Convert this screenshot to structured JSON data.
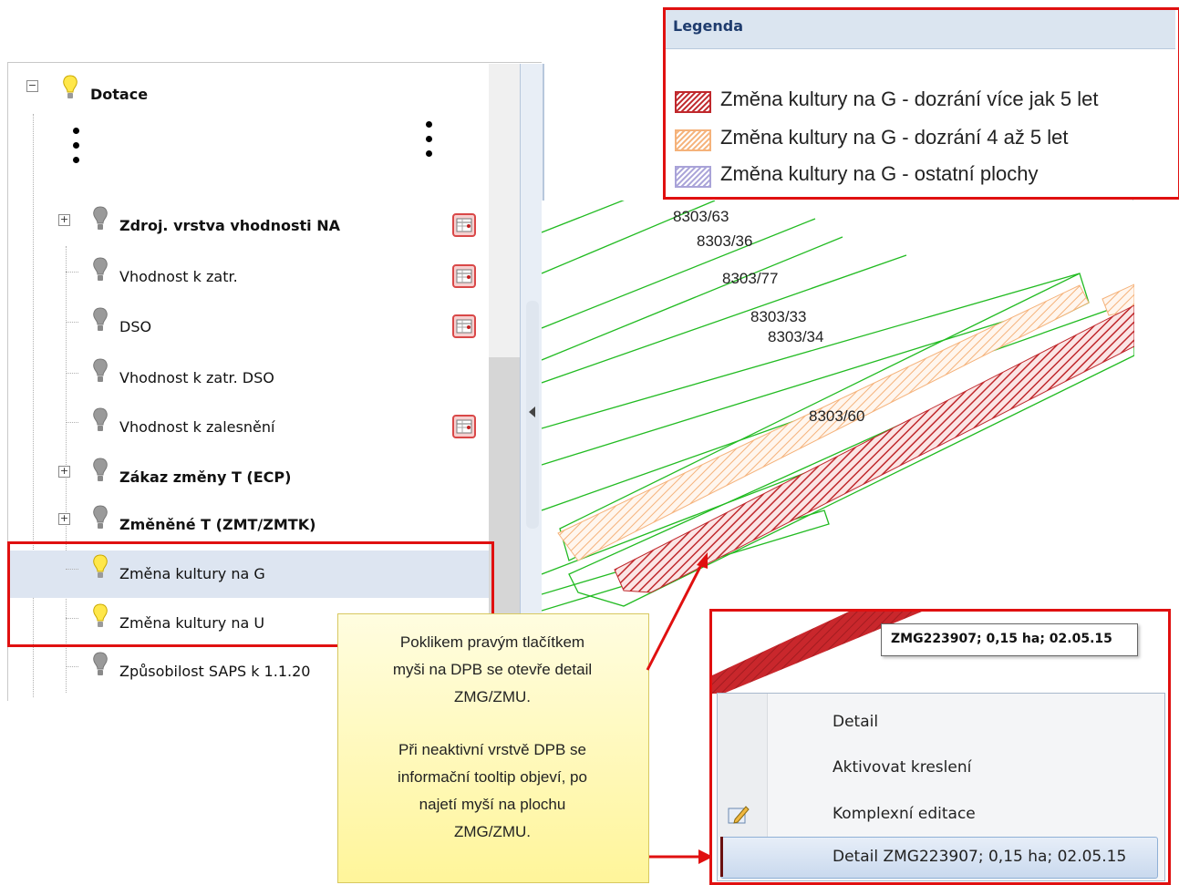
{
  "tree": {
    "root": {
      "label": "Dotace",
      "expander": "−"
    },
    "items": [
      {
        "label": "Zdroj. vrstva vhodnosti NA",
        "bold": true,
        "expander": "+"
      },
      {
        "label": "Vhodnost k zatr.",
        "bold": false
      },
      {
        "label": "DSO",
        "bold": false
      },
      {
        "label": "Vhodnost k zatr. DSO",
        "bold": false
      },
      {
        "label": "Vhodnost k zalesnění",
        "bold": false
      },
      {
        "label": "Zákaz změny T (ECP)",
        "bold": true,
        "expander": "+"
      },
      {
        "label": "Změněné T (ZMT/ZMTK)",
        "bold": true,
        "expander": "+"
      },
      {
        "label": "Změna kultury na G",
        "bold": false,
        "selected": true
      },
      {
        "label": "Změna kultury na U",
        "bold": false
      },
      {
        "label": "Způsobilost SAPS k 1.1.20",
        "bold": false
      }
    ]
  },
  "legend": {
    "title": "Legenda",
    "items": [
      {
        "label": "Změna kultury na G - dozrání více jak 5 let",
        "color": "#c0282c"
      },
      {
        "label": "Změna kultury na G - dozrání 4 až 5 let",
        "color": "#f5b27a"
      },
      {
        "label": "Změna kultury na G - ostatní plochy",
        "color": "#a9a3d8"
      }
    ]
  },
  "map": {
    "parcels": [
      "8303/63",
      "8303/36",
      "8303/77",
      "8303/33",
      "8303/34",
      "8303/60"
    ],
    "colors": {
      "boundary": "#22bb22",
      "mature": "#c0282c",
      "young": "#f5b27a"
    }
  },
  "callout": {
    "p1": [
      "Poklikem pravým tlačítkem",
      "myši na DPB se otevře detail",
      "ZMG/ZMU."
    ],
    "p2": [
      "Při neaktivní vrstvě DPB se",
      "informační tooltip objeví, po",
      "najetí myší na plochu",
      "ZMG/ZMU."
    ]
  },
  "tooltip": "ZMG223907; 0,15 ha; 02.05.15",
  "menu": {
    "items": [
      {
        "label": "Detail",
        "icon": ""
      },
      {
        "label": "Aktivovat kreslení",
        "icon": ""
      },
      {
        "label": "Komplexní editace",
        "icon": "edit-pencil-icon"
      },
      {
        "label": "Detail ZMG223907; 0,15 ha; 02.05.15",
        "icon": "",
        "hover": true
      }
    ]
  },
  "colors": {
    "highlight": "#e01010",
    "accent_blue": "#1f3c6e"
  }
}
